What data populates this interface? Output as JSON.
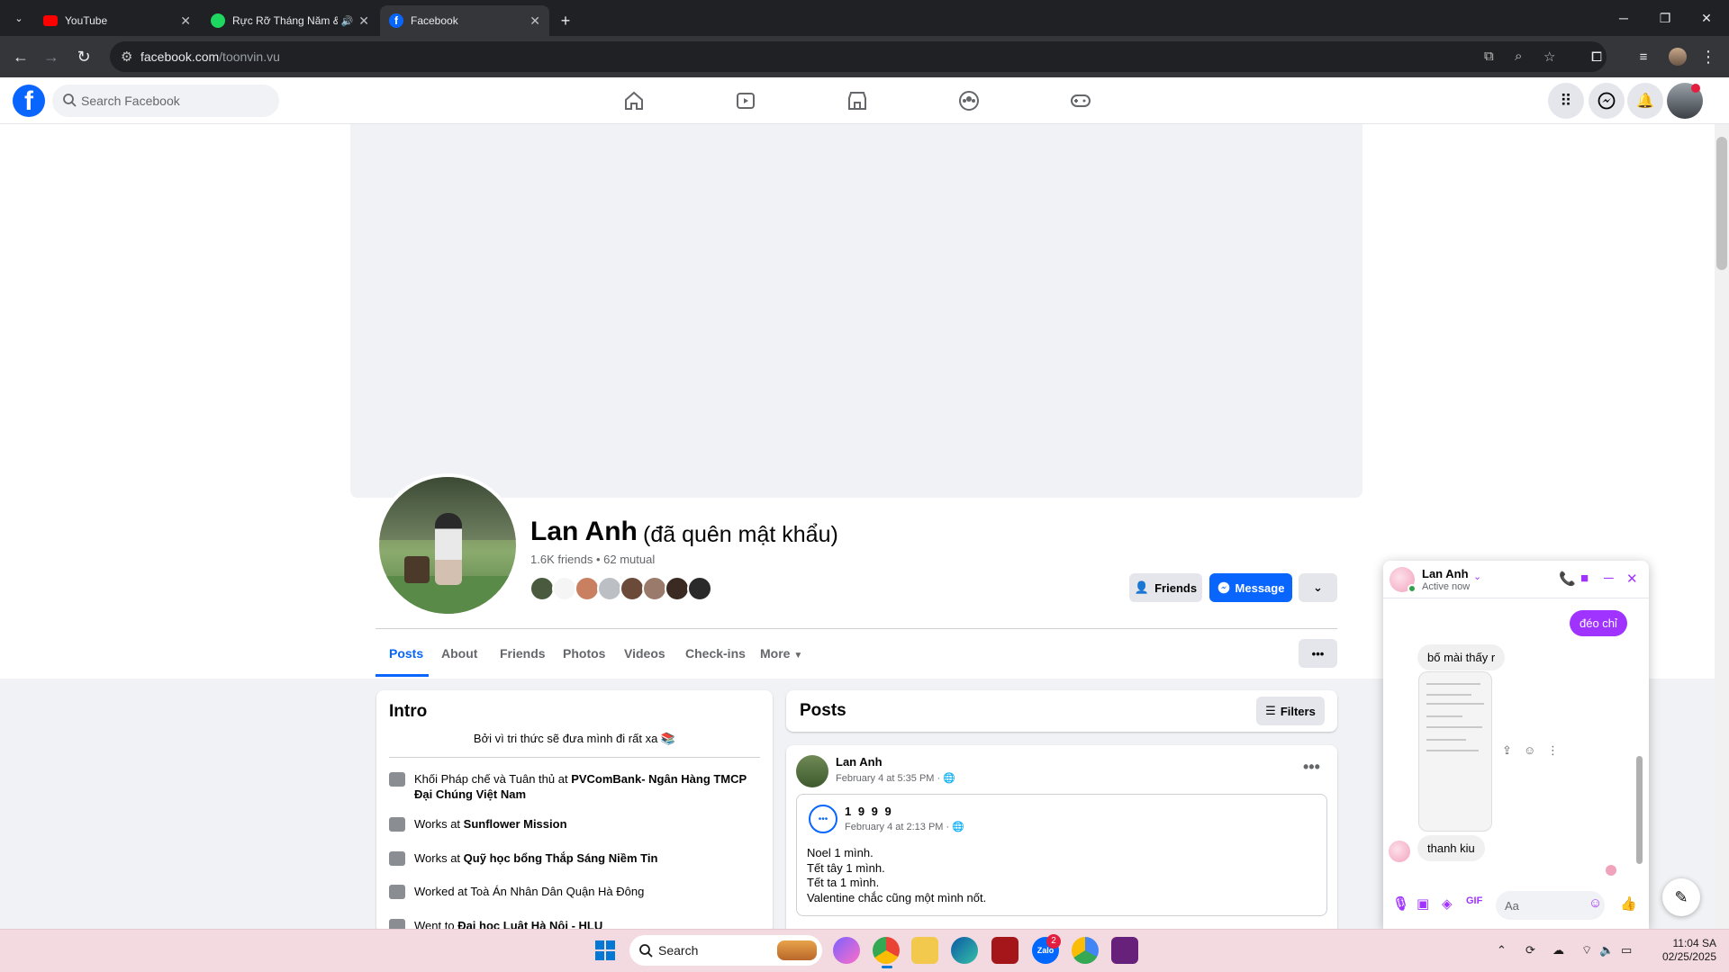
{
  "browser": {
    "tabs": [
      {
        "title": "YouTube",
        "color": "#ff0000"
      },
      {
        "title": "Rực Rỡ Tháng Năm & Con (",
        "color": "#1ed760"
      },
      {
        "title": "Facebook",
        "color": "#0866ff"
      }
    ],
    "url_host": "facebook.com",
    "url_path": "/toonvin.vu"
  },
  "fb": {
    "search_placeholder": "Search Facebook"
  },
  "profile": {
    "name": "Lan Anh",
    "alternate_name": "(đã quên mật khẩu)",
    "friend_count": "1.6K friends • 62 mutual",
    "friends_button": "Friends",
    "message_button": "Message",
    "tabs": [
      "Posts",
      "About",
      "Friends",
      "Photos",
      "Videos",
      "Check-ins",
      "More"
    ]
  },
  "intro": {
    "title": "Intro",
    "bio": "Bởi vì tri thức sẽ đưa mình đi rất xa 📚",
    "items": [
      {
        "prefix": "Khối Pháp chế và Tuân thủ at ",
        "bold": "PVComBank- Ngân Hàng TMCP Đại Chúng Việt Nam"
      },
      {
        "prefix": "Works at ",
        "bold": "Sunflower Mission"
      },
      {
        "prefix": "Works at ",
        "bold": "Quỹ học bổng Thắp Sáng Niềm Tin"
      },
      {
        "prefix": "Worked at Toà Án Nhân Dân Quận Hà Đông",
        "bold": ""
      },
      {
        "prefix": "Went to ",
        "bold": "Đại học Luật Hà Nội - HLU"
      }
    ]
  },
  "posts": {
    "title": "Posts",
    "filters_label": "Filters",
    "post": {
      "author": "Lan Anh",
      "date": "February 4 at 5:35 PM · 🌐",
      "shared_author": "1 9 9 9",
      "shared_date": "February 4 at 2:13 PM · 🌐",
      "lines": [
        "Noel 1 mình.",
        "Tết tây 1 mình.",
        "Tết ta 1 mình.",
        "Valentine chắc cũng một mình nốt."
      ]
    }
  },
  "chat": {
    "name": "Lan Anh",
    "status": "Active now",
    "messages": {
      "me_1": "đéo chỉ",
      "them_1": "bố mài thấy r",
      "them_2": "thanh kiu"
    },
    "input_placeholder": "Aa"
  },
  "taskbar": {
    "search_label": "Search",
    "zalo_badge": "2",
    "time": "11:04 SA",
    "date": "02/25/2025"
  }
}
